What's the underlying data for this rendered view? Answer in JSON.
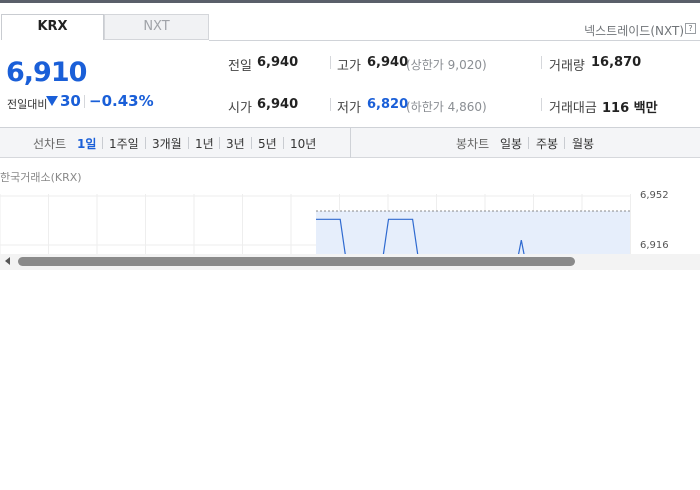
{
  "tabs": [
    {
      "label": "KRX",
      "active": true
    },
    {
      "label": "NXT",
      "active": false
    }
  ],
  "nxt_link": {
    "label": "넥스트레이드(NXT)",
    "help_icon": "?"
  },
  "quote": {
    "price": "6,910",
    "diff_label": "전일대비",
    "diff_direction": "down",
    "diff_value": "30",
    "diff_percent": "−0.43%"
  },
  "stats": {
    "prev_close": {
      "label": "전일",
      "value": "6,940"
    },
    "open": {
      "label": "시가",
      "value": "6,940"
    },
    "high": {
      "label": "고가",
      "value": "6,940",
      "limit": "(상한가 9,020)"
    },
    "low": {
      "label": "저가",
      "value": "6,820",
      "limit": "(하한가 4,860)"
    },
    "volume": {
      "label": "거래량",
      "value": "16,870"
    },
    "amount": {
      "label": "거래대금",
      "value": "116 백만"
    }
  },
  "line_chart_periods": {
    "label": "선차트",
    "options": [
      "1일",
      "1주일",
      "3개월",
      "1년",
      "3년",
      "5년",
      "10년"
    ],
    "selected": "1일"
  },
  "candle_chart_periods": {
    "label": "봉차트",
    "options": [
      "일봉",
      "주봉",
      "월봉"
    ]
  },
  "exchange_label": "한국거래소(KRX)",
  "chart_data": {
    "type": "line",
    "y_ticks": [
      "6,952",
      "6,916"
    ],
    "ylim": [
      6900,
      6952
    ],
    "series": [
      {
        "values": [
          6940,
          6940,
          6940,
          6820,
          6820,
          6820,
          6940,
          6940,
          6940,
          6820,
          6820,
          6820,
          6880,
          6820,
          6820,
          6820,
          6820,
          6910,
          6820,
          6820,
          6820,
          6820,
          6820,
          6820,
          6880,
          6820,
          6820
        ]
      }
    ],
    "colors": {
      "line": "#2f6ad0",
      "fill": "#e6eefb",
      "grid": "#eeeeee"
    }
  }
}
